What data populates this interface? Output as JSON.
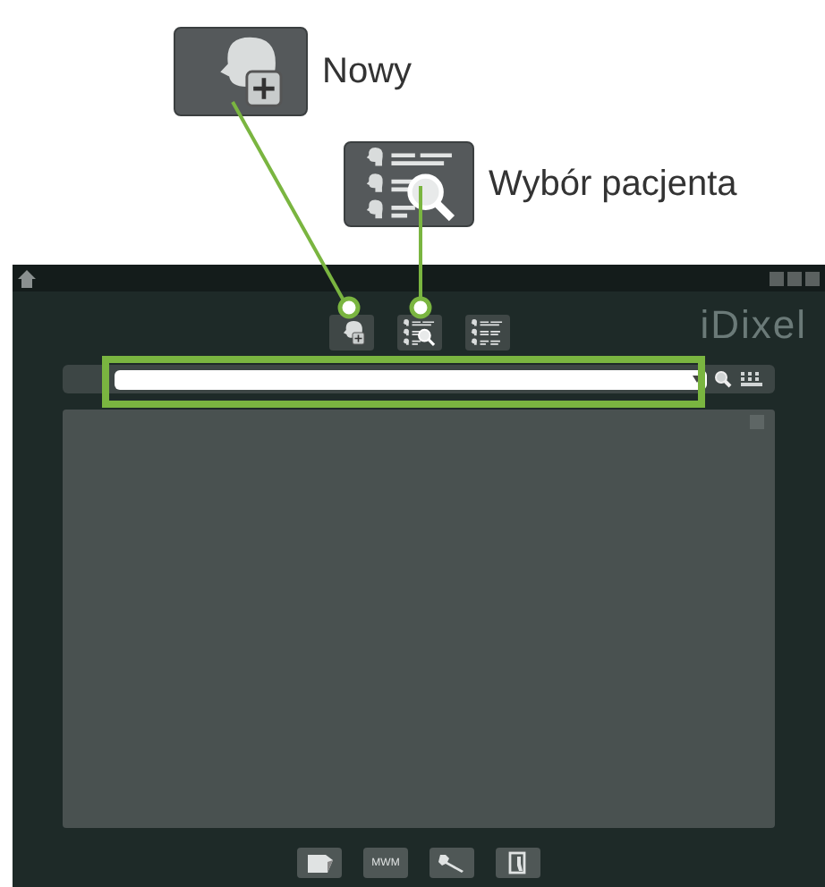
{
  "callouts": [
    {
      "kind": "new",
      "label": "Nowy"
    },
    {
      "kind": "search",
      "label": "Wybór pacjenta"
    }
  ],
  "window": {
    "logo": "iDixel"
  },
  "bottom_buttons": [
    {
      "kind": "notes"
    },
    {
      "kind": "text",
      "label": "MWM"
    },
    {
      "kind": "wrench"
    },
    {
      "kind": "exit"
    }
  ]
}
